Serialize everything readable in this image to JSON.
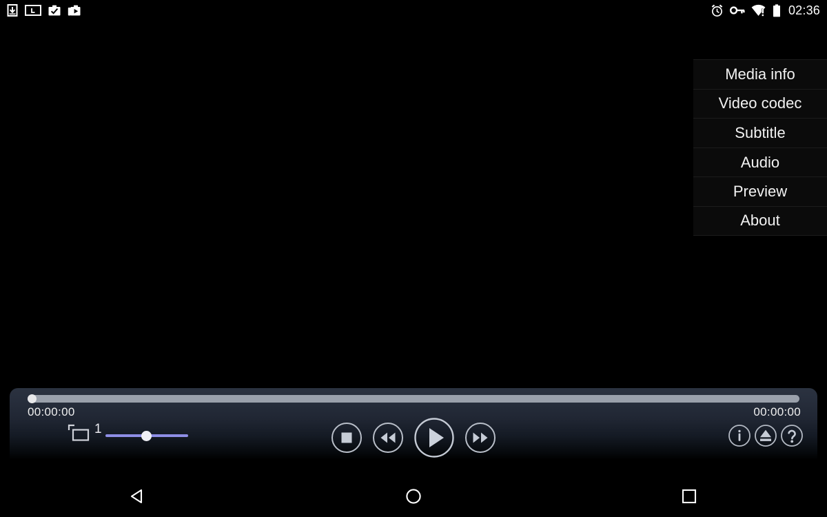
{
  "status_bar": {
    "left_icons": [
      {
        "name": "download-icon",
        "label": "Download"
      },
      {
        "name": "screen-notification-icon",
        "label": "L"
      },
      {
        "name": "check-briefcase-icon",
        "label": "Work profile check"
      },
      {
        "name": "media-briefcase-icon",
        "label": "Work profile media"
      }
    ],
    "right_icons": [
      {
        "name": "alarm-clock-icon",
        "label": "Alarm set"
      },
      {
        "name": "vpn-key-icon",
        "label": "VPN"
      },
      {
        "name": "wifi-warning-icon",
        "label": "Wi-Fi no internet"
      },
      {
        "name": "battery-icon",
        "label": "Battery"
      }
    ],
    "clock": "02:36"
  },
  "menu": {
    "items": [
      {
        "label": "Media info"
      },
      {
        "label": "Video codec"
      },
      {
        "label": "Subtitle"
      },
      {
        "label": "Audio"
      },
      {
        "label": "Preview"
      },
      {
        "label": "About"
      }
    ]
  },
  "player": {
    "seek": {
      "position_percent": 0,
      "elapsed": "00:00:00",
      "total": "00:00:00"
    },
    "scale": {
      "icon": "scale-resize-icon",
      "value": "1",
      "slider_percent": 45
    },
    "transport": [
      {
        "name": "stop-button",
        "label": "Stop"
      },
      {
        "name": "rewind-button",
        "label": "Rewind"
      },
      {
        "name": "play-button",
        "label": "Play"
      },
      {
        "name": "fast-forward-button",
        "label": "Fast forward"
      }
    ],
    "aux": [
      {
        "name": "info-button",
        "label": "Info"
      },
      {
        "name": "eject-button",
        "label": "Open file"
      },
      {
        "name": "help-button",
        "label": "Help"
      }
    ]
  },
  "nav_bar": {
    "buttons": [
      {
        "name": "back-button",
        "label": "Back"
      },
      {
        "name": "home-button",
        "label": "Home"
      },
      {
        "name": "recents-button",
        "label": "Recents"
      }
    ]
  },
  "colors": {
    "panel_top": "#2b3240",
    "panel_bottom": "#000000",
    "seek_track": "#9aa0ab",
    "scale_slider": "#8e8ee6",
    "menu_row": "#0b0b0b",
    "text": "#f2f2f2"
  }
}
